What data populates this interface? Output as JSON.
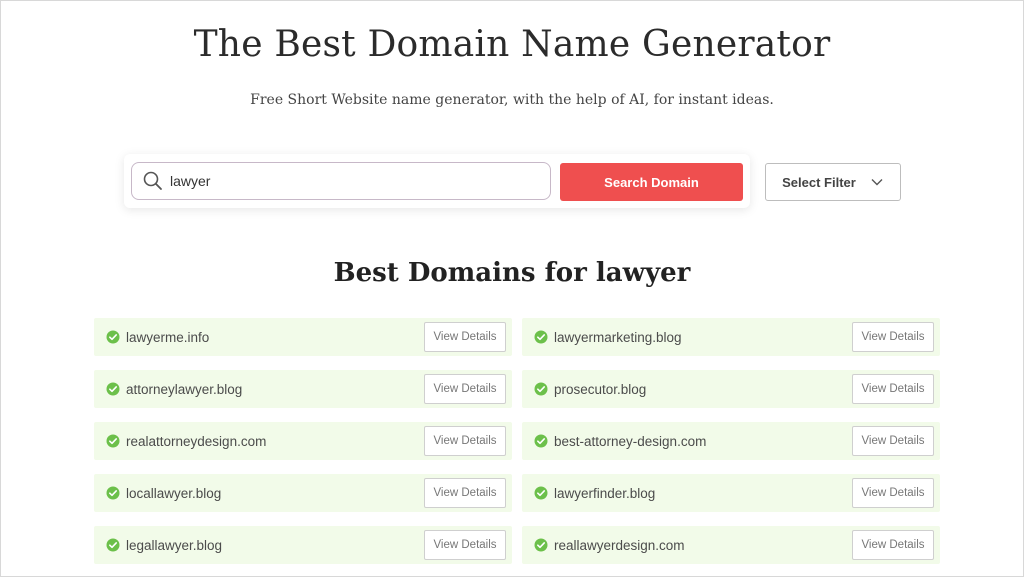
{
  "header": {
    "title": "The Best Domain Name Generator",
    "subtitle": "Free Short Website name generator, with the help of AI, for instant ideas."
  },
  "search": {
    "value": "lawyer",
    "button_label": "Search Domain",
    "filter_label": "Select Filter"
  },
  "results": {
    "heading_prefix": "Best Domains for",
    "keyword": "lawyer",
    "view_label": "View Details",
    "accent_color": "#ef4f4f",
    "available_color": "#6cc04a",
    "items": [
      {
        "domain": "lawyerme.info"
      },
      {
        "domain": "lawyermarketing.blog"
      },
      {
        "domain": "attorneylawyer.blog"
      },
      {
        "domain": "prosecutor.blog"
      },
      {
        "domain": "realattorneydesign.com"
      },
      {
        "domain": "best-attorney-design.com"
      },
      {
        "domain": "locallawyer.blog"
      },
      {
        "domain": "lawyerfinder.blog"
      },
      {
        "domain": "legallawyer.blog"
      },
      {
        "domain": "reallawyerdesign.com"
      }
    ]
  }
}
